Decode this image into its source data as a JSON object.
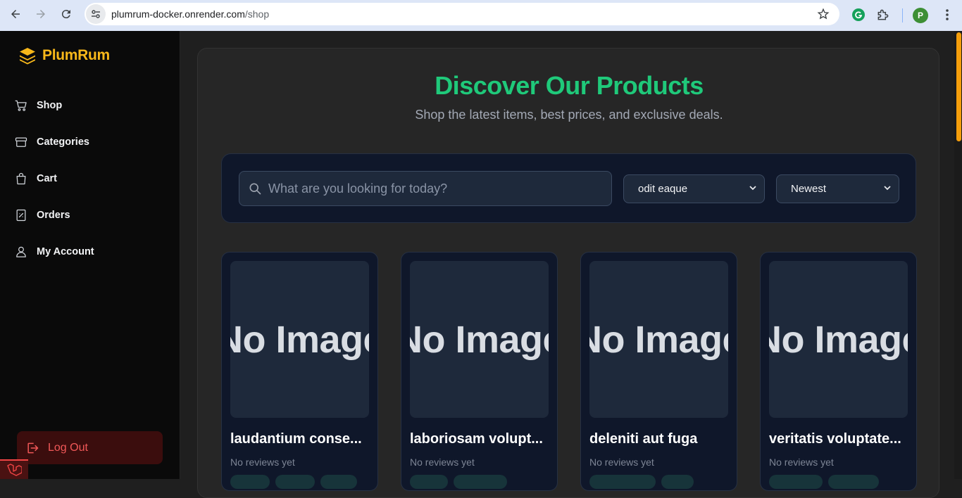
{
  "browser": {
    "url_host": "plumrum-docker.onrender.com",
    "url_path": "/shop",
    "profile_initial": "P"
  },
  "sidebar": {
    "brand": "PlumRum",
    "items": [
      {
        "label": "Shop",
        "icon": "cart-icon"
      },
      {
        "label": "Categories",
        "icon": "archive-box-icon"
      },
      {
        "label": "Cart",
        "icon": "shopping-bag-icon"
      },
      {
        "label": "Orders",
        "icon": "receipt-icon"
      },
      {
        "label": "My Account",
        "icon": "user-icon"
      }
    ],
    "logout_label": "Log Out"
  },
  "main": {
    "title": "Discover Our Products",
    "subtitle": "Shop the latest items, best prices, and exclusive deals."
  },
  "filters": {
    "search_placeholder": "What are you looking for today?",
    "category_selected": "odit eaque",
    "sort_selected": "Newest"
  },
  "products": [
    {
      "image_text": "No Image",
      "name": "laudantium conse...",
      "reviews": "No reviews yet"
    },
    {
      "image_text": "No Image",
      "name": "laboriosam volupt...",
      "reviews": "No reviews yet"
    },
    {
      "image_text": "No Image",
      "name": "deleniti aut fuga",
      "reviews": "No reviews yet"
    },
    {
      "image_text": "No Image",
      "name": "veritatis voluptate...",
      "reviews": "No reviews yet"
    }
  ],
  "colors": {
    "brand": "#f8b81a",
    "accent_green": "#1fc97a",
    "logout_red": "#f15858"
  }
}
